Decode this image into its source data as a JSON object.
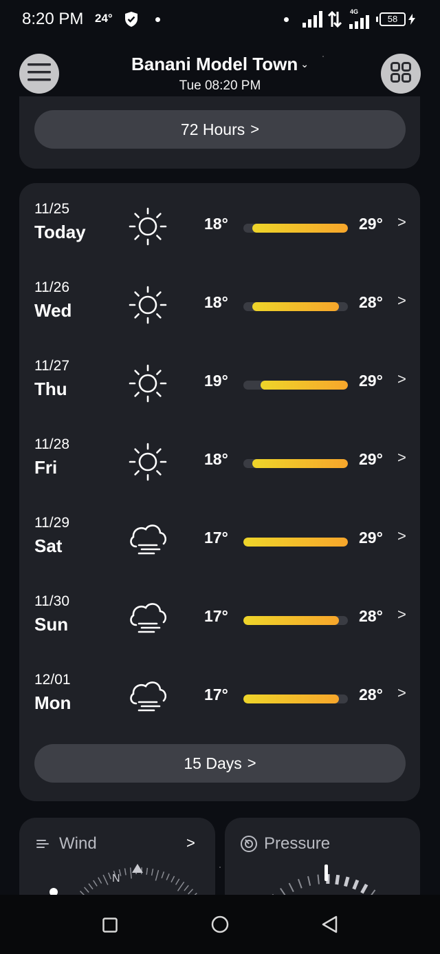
{
  "status_bar": {
    "time": "8:20 PM",
    "temp": "24°",
    "network": "4G",
    "battery": "58",
    "icons": [
      "shield-icon",
      "signal-icon",
      "data-arrows-icon",
      "battery-icon",
      "charging-bolt-icon"
    ]
  },
  "header": {
    "location": "Banani Model Town",
    "datetime": "Tue 08:20 PM",
    "menu_icon": "hamburger-menu-icon",
    "grid_icon": "grid-icon"
  },
  "hours_button": {
    "label": "72 Hours",
    "chevron": ">"
  },
  "forecast": {
    "scale_min": 17,
    "scale_max": 29,
    "days": [
      {
        "date": "11/25",
        "day": "Today",
        "icon": "sun-icon",
        "low": 18,
        "high": 29,
        "low_label": "18°",
        "high_label": "29°"
      },
      {
        "date": "11/26",
        "day": "Wed",
        "icon": "sun-icon",
        "low": 18,
        "high": 28,
        "low_label": "18°",
        "high_label": "28°"
      },
      {
        "date": "11/27",
        "day": "Thu",
        "icon": "sun-icon",
        "low": 19,
        "high": 29,
        "low_label": "19°",
        "high_label": "29°"
      },
      {
        "date": "11/28",
        "day": "Fri",
        "icon": "sun-icon",
        "low": 18,
        "high": 29,
        "low_label": "18°",
        "high_label": "29°"
      },
      {
        "date": "11/29",
        "day": "Sat",
        "icon": "haze-cloud-icon",
        "low": 17,
        "high": 29,
        "low_label": "17°",
        "high_label": "29°"
      },
      {
        "date": "11/30",
        "day": "Sun",
        "icon": "haze-cloud-icon",
        "low": 17,
        "high": 28,
        "low_label": "17°",
        "high_label": "28°"
      },
      {
        "date": "12/01",
        "day": "Mon",
        "icon": "haze-cloud-icon",
        "low": 17,
        "high": 28,
        "low_label": "17°",
        "high_label": "28°"
      }
    ]
  },
  "days_button": {
    "label": "15 Days",
    "chevron": ">"
  },
  "wind_card": {
    "title": "Wind",
    "compass": "N",
    "icon": "wind-icon",
    "chevron": ">"
  },
  "pressure_card": {
    "title": "Pressure",
    "icon": "pressure-gauge-icon"
  },
  "nav": {
    "icons": [
      "recents-square-icon",
      "home-circle-icon",
      "back-triangle-icon"
    ]
  },
  "colors": {
    "background": "#0c0e13",
    "card": "#1f2127",
    "button": "#3e4047",
    "bar_start": "#eed52a",
    "bar_end": "#f7a62b"
  }
}
